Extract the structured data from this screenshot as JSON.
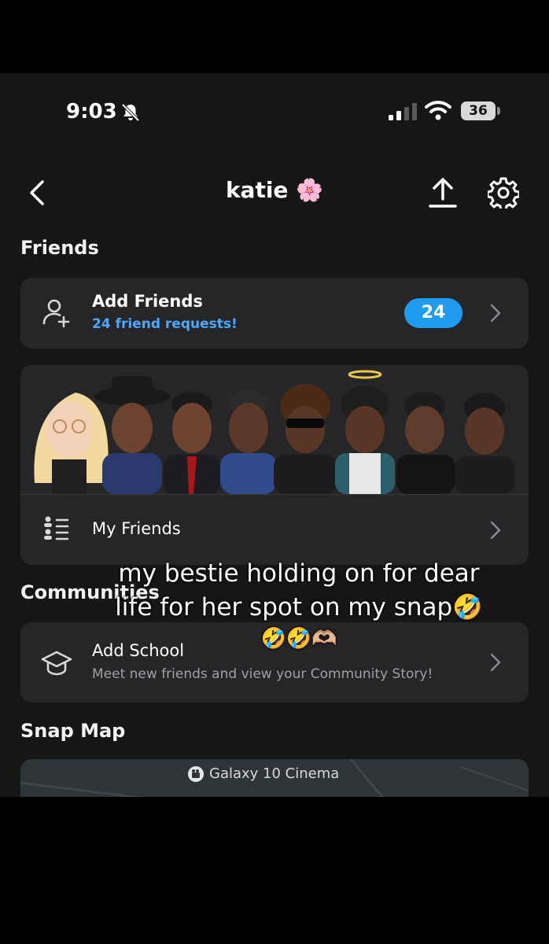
{
  "status_bar": {
    "time": "9:03",
    "battery": "36"
  },
  "header": {
    "title": "katie 🌸"
  },
  "friends_section": {
    "title": "Friends"
  },
  "add_friends": {
    "title": "Add Friends",
    "subtitle": "24 friend requests!",
    "badge": "24"
  },
  "my_friends": {
    "label": "My Friends"
  },
  "communities_section": {
    "title": "Communities"
  },
  "add_school": {
    "title": "Add School",
    "subtitle": "Meet new friends and view your Community Story!"
  },
  "snap_map_section": {
    "title": "Snap Map"
  },
  "map": {
    "place_label": "Galaxy 10 Cinema"
  },
  "overlay_caption": {
    "line1": "my bestie holding on for dear",
    "line2": "life for her spot on my snap🤣",
    "line3": "🤣🤣🫶🏼"
  },
  "colors": {
    "background": "#161617",
    "card": "#262628",
    "accent_blue": "#1f9bf0",
    "subtitle_blue": "#4aa9ff"
  }
}
